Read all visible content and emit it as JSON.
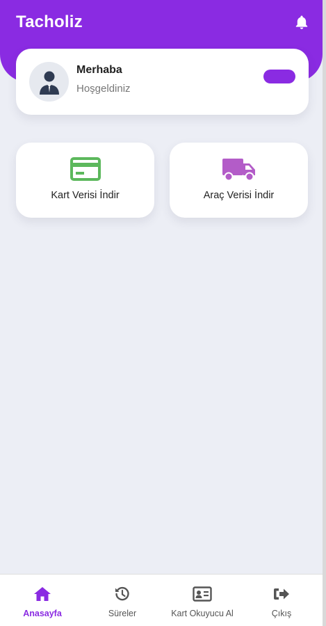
{
  "app": {
    "title": "Tacholiz"
  },
  "header": {
    "notification_icon": "bell-icon"
  },
  "welcome": {
    "greeting": "Merhaba",
    "subtitle": "Hoşgeldiniz",
    "avatar_icon": "user-avatar-icon"
  },
  "actions": [
    {
      "label": "Kart Verisi İndir",
      "icon": "credit-card-icon",
      "color": "#5cb85c"
    },
    {
      "label": "Araç Verisi İndir",
      "icon": "truck-icon",
      "color": "#b35cc8"
    }
  ],
  "bottom_nav": [
    {
      "label": "Anasayfa",
      "icon": "home-icon",
      "active": true
    },
    {
      "label": "Süreler",
      "icon": "history-icon",
      "active": false
    },
    {
      "label": "Kart Okuyucu Al",
      "icon": "id-card-icon",
      "active": false
    },
    {
      "label": "Çıkış",
      "icon": "logout-icon",
      "active": false
    }
  ],
  "colors": {
    "primary": "#8a2be2",
    "background": "#eceef5",
    "card": "#ffffff"
  }
}
